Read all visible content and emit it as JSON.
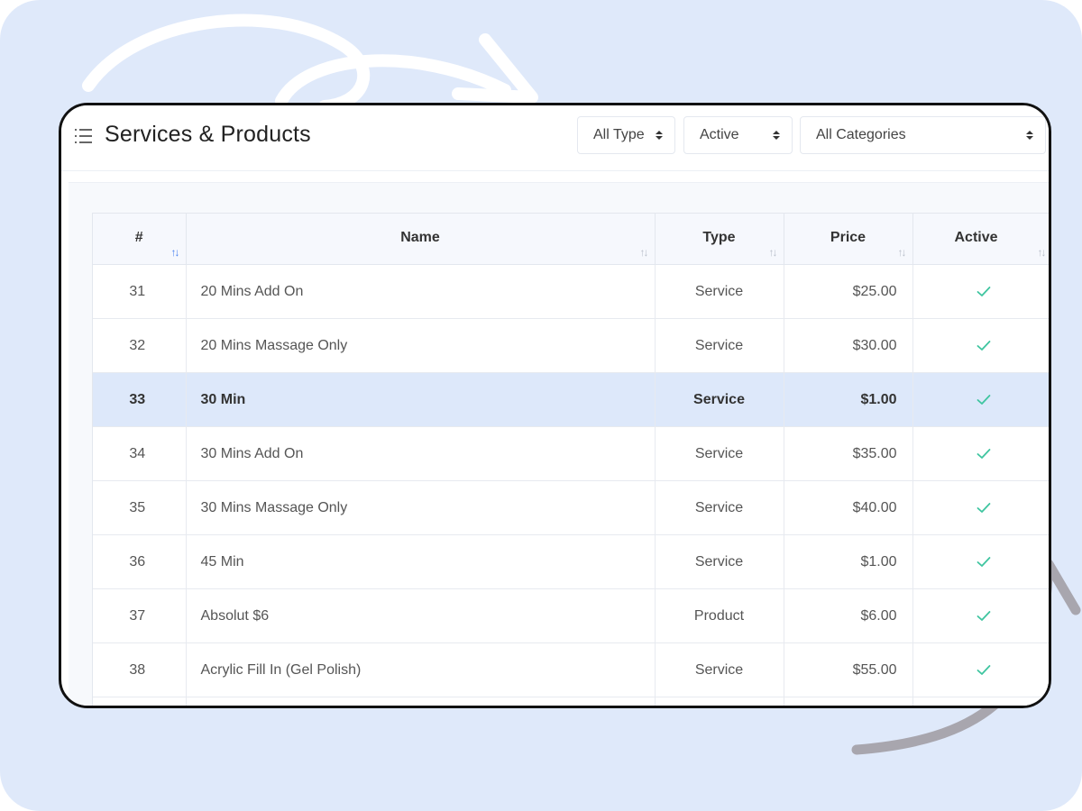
{
  "header": {
    "title": "Services & Products"
  },
  "filters": {
    "type": "All Type",
    "status": "Active",
    "category": "All Categories"
  },
  "table": {
    "columns": [
      "#",
      "Name",
      "Type",
      "Price",
      "Active"
    ],
    "rows": [
      {
        "num": "31",
        "name": "20 Mins Add On",
        "type": "Service",
        "price": "$25.00",
        "active": true
      },
      {
        "num": "32",
        "name": "20 Mins Massage Only",
        "type": "Service",
        "price": "$30.00",
        "active": true
      },
      {
        "num": "33",
        "name": "30 Min",
        "type": "Service",
        "price": "$1.00",
        "active": true
      },
      {
        "num": "34",
        "name": "30 Mins Add On",
        "type": "Service",
        "price": "$35.00",
        "active": true
      },
      {
        "num": "35",
        "name": "30 Mins Massage Only",
        "type": "Service",
        "price": "$40.00",
        "active": true
      },
      {
        "num": "36",
        "name": "45 Min",
        "type": "Service",
        "price": "$1.00",
        "active": true
      },
      {
        "num": "37",
        "name": "Absolut $6",
        "type": "Product",
        "price": "$6.00",
        "active": true
      },
      {
        "num": "38",
        "name": "Acrylic Fill In (Gel Polish)",
        "type": "Service",
        "price": "$55.00",
        "active": true
      },
      {
        "num": "",
        "name": "",
        "type": "",
        "price": "",
        "active": false
      }
    ],
    "highlighted_row": "33"
  },
  "colors": {
    "background": "#dfe9fa",
    "highlight_row": "#dde8fa",
    "check": "#3fc5a0",
    "sort_active": "#4a82f0",
    "arrow_gray": "#a8a6ae"
  }
}
